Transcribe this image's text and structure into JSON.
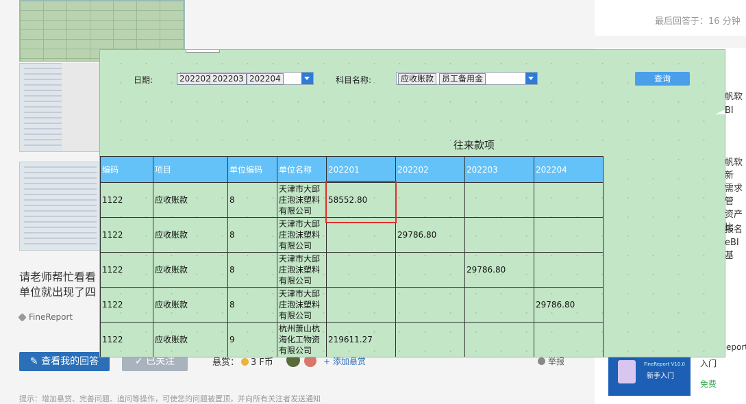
{
  "background": {
    "question_title_line1": "请老师帮忙看看",
    "question_title_line2": "单位就出现了四",
    "tag": "FineReport",
    "view_my_answer": "查看我的回答",
    "follow": "已关注",
    "reward_label": "悬赏：",
    "reward_value": "3 F币",
    "add_reward": "+ 添加悬赏",
    "report": "举报",
    "hint": "提示：增加悬赏、完善问题、追问等操作，可使您的问题被置顶，并向所有关注者发送通知",
    "last_answer": "最后回答于：16 分钟",
    "side_items": [
      [
        "帆软BI"
      ],
      [
        "帆软新",
        "需求管",
        "资产比"
      ],
      [
        "报名",
        "eBI基"
      ]
    ],
    "side_finereport": "eport",
    "side_intro": "入门",
    "free": "免费",
    "promo_line1": "FineReport V10.0",
    "promo_line2": "新手入门"
  },
  "report": {
    "date_label": "日期:",
    "date_chips": [
      "202202",
      "202203",
      "202204"
    ],
    "subject_label": "科目名称:",
    "subject_chips": [
      "应收账款",
      "员工备用金"
    ],
    "query_button": "查询",
    "title": "往来款项",
    "columns": [
      "编码",
      "项目",
      "单位编码",
      "单位名称",
      "202201",
      "202202",
      "202203",
      "202204"
    ],
    "rows": [
      [
        "1122",
        "应收账款",
        "8",
        "天津市大邱庄泡沫塑料有限公司",
        "58552.80",
        "",
        "",
        ""
      ],
      [
        "1122",
        "应收账款",
        "8",
        "天津市大邱庄泡沫塑料有限公司",
        "",
        "29786.80",
        "",
        ""
      ],
      [
        "1122",
        "应收账款",
        "8",
        "天津市大邱庄泡沫塑料有限公司",
        "",
        "",
        "29786.80",
        ""
      ],
      [
        "1122",
        "应收账款",
        "8",
        "天津市大邱庄泡沫塑料有限公司",
        "",
        "",
        "",
        "29786.80"
      ],
      [
        "1122",
        "应收账款",
        "9",
        "杭州萧山杭海化工物资有限公司",
        "219611.27",
        "",
        "",
        ""
      ]
    ],
    "colors": {
      "background": "#c3e6c7",
      "header": "#64c2f8",
      "button": "#4a9fea",
      "highlight": "#e02d2d"
    }
  }
}
